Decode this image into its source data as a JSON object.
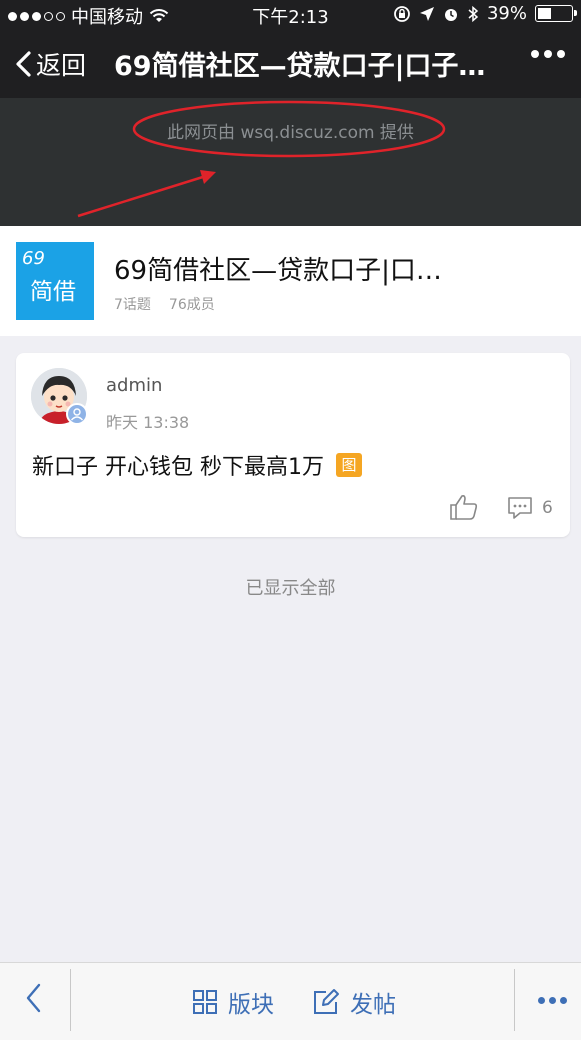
{
  "status_bar": {
    "carrier": "中国移动",
    "time": "下午2:13",
    "battery": "39%",
    "battery_fraction": 0.39
  },
  "nav": {
    "back_label": "返回",
    "title": "69简借社区—贷款口子|口子…"
  },
  "provider": {
    "text": "此网页由 wsq.discuz.com 提供"
  },
  "community": {
    "logo_line1": "69",
    "logo_line2": "简借",
    "name": "69简借社区—贷款口子|口…",
    "topics": "7话题",
    "members": "76成员",
    "logo_color": "#1ba2e6"
  },
  "post": {
    "author": "admin",
    "time": "昨天 13:38",
    "content": "新口子 开心钱包 秒下最高1万",
    "tag": "图",
    "comment_count": "6",
    "tag_color": "#f5a623"
  },
  "footer_note": "已显示全部",
  "toolbar": {
    "sections_label": "版块",
    "post_label": "发帖",
    "accent": "#3e6fb6"
  }
}
